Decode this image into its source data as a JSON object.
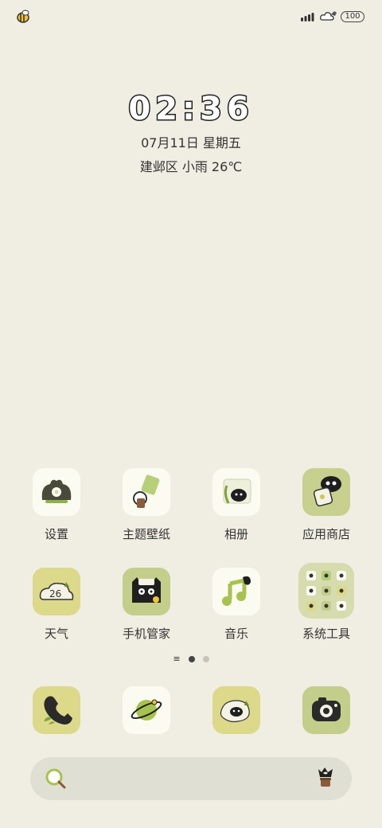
{
  "status_bar": {
    "left_icon": "bee-sticker-icon",
    "signal_icon": "signal-bars-icon",
    "wifi_icon": "cloud-wifi-icon",
    "battery": "100"
  },
  "clock": {
    "time": "02:36",
    "date": "07月11日 星期五",
    "weather": "建邺区 小雨 26℃"
  },
  "apps": [
    {
      "label": "设置",
      "icon": "settings-icon",
      "color": "#fbfbf2"
    },
    {
      "label": "主题壁纸",
      "icon": "theme-wallpaper-icon",
      "color": "#fbfbf2"
    },
    {
      "label": "相册",
      "icon": "gallery-icon",
      "color": "#fbfbf2"
    },
    {
      "label": "应用商店",
      "icon": "app-store-icon",
      "color": "#c8d08e"
    },
    {
      "label": "天气",
      "icon": "weather-icon",
      "color": "#dcd98a",
      "text": "26"
    },
    {
      "label": "手机管家",
      "icon": "phone-manager-icon",
      "color": "#c3ce8a"
    },
    {
      "label": "音乐",
      "icon": "music-icon",
      "color": "#fbfbf2"
    },
    {
      "label": "系统工具",
      "icon": "system-tools-folder-icon",
      "color": "#d7dcaf"
    }
  ],
  "dock": [
    {
      "icon": "phone-icon",
      "color": "#dcd98a"
    },
    {
      "icon": "browser-icon",
      "color": "#fbfbf2"
    },
    {
      "icon": "messages-icon",
      "color": "#dcd98a"
    },
    {
      "icon": "camera-icon",
      "color": "#c3ce8a"
    }
  ],
  "page_indicator": {
    "pages": 2,
    "active": 1
  },
  "search": {
    "left_icon": "search-icon",
    "right_icon": "plant-pot-icon"
  }
}
